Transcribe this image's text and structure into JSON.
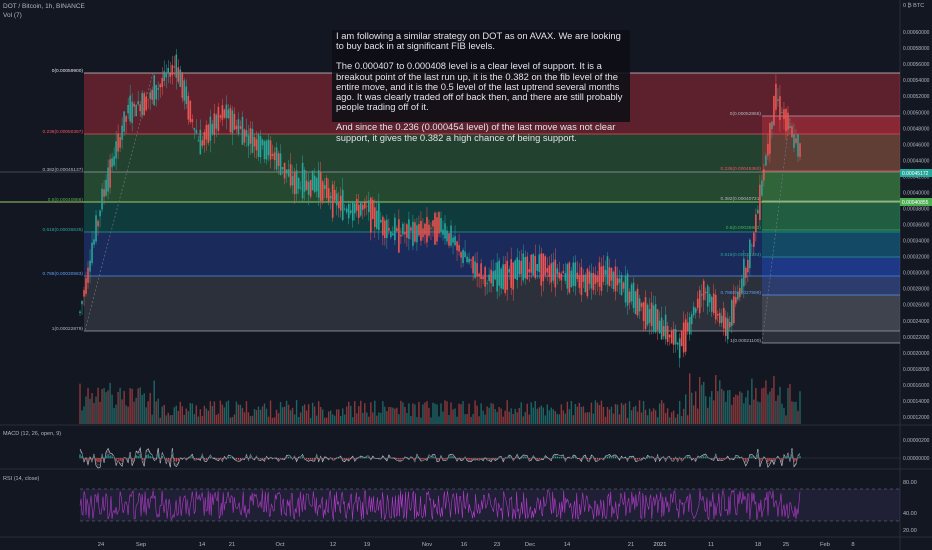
{
  "header": {
    "symbol": "DOT / Bitcoin, 1h, BINANCE",
    "vol": "Vol (7)",
    "price_axis_unit": "0 ₿ BTC"
  },
  "note": {
    "p1": "I am following a similar strategy on DOT as on AVAX. We are looking to buy back in at significant FIB levels.",
    "p2": "The 0.000407 to 0.000408 level is a clear level of support. It is a breakout point of the last run up, it is the 0.382 on the fib level of the entire move, and it is the 0.5 level of the last uptrend several months ago. It was clearly traded off of back then, and there are still probably people trading off of it.",
    "p3": "And since the 0.236 (0.000454 level) of the last move was not clear support, it gives the 0.382 a high chance of being support."
  },
  "fib_left": [
    {
      "label": "0(0.00059900)",
      "color": "#e0e0e0"
    },
    {
      "label": "0.236(0.00050397)",
      "color": "#f7525f"
    },
    {
      "label": "0.382(0.00045137)",
      "color": "#b2b5be"
    },
    {
      "label": "0.5(0.00040886)",
      "color": "#4caf50"
    },
    {
      "label": "0.618(0.00036635)",
      "color": "#26a69a"
    },
    {
      "label": "0.786(0.00030583)",
      "color": "#5b9cf6"
    },
    {
      "label": "1(0.00022879)",
      "color": "#b2b5be"
    }
  ],
  "fib_right": [
    {
      "label": "0(0.00052865)",
      "color": "#b2b5be"
    },
    {
      "label": "0.236(0.00045360)",
      "color": "#f7525f"
    },
    {
      "label": "0.382(0.00040721)",
      "color": "#b2b5be"
    },
    {
      "label": "0.5(0.00036983)",
      "color": "#4caf50"
    },
    {
      "label": "0.618(0.00033234)",
      "color": "#26a69a"
    },
    {
      "label": "0.786(0.00027899)",
      "color": "#5b9cf6"
    },
    {
      "label": "1(0.00021100)",
      "color": "#b2b5be"
    }
  ],
  "price_badges": [
    {
      "label": "0.00045172",
      "color": "#26a69a"
    },
    {
      "label": "0.00040855",
      "color": "#4caf50"
    }
  ],
  "macd": {
    "title": "MACD (12, 26, open, 9)",
    "ticks": [
      "0.00000200",
      "0.00000000"
    ]
  },
  "rsi": {
    "title": "RSI (14, close)",
    "ticks": [
      "80.00",
      "40.00",
      "20.00"
    ]
  },
  "chart_data": {
    "type": "line",
    "title": "DOT / Bitcoin, 1h, BINANCE",
    "xlabel": "",
    "ylabel": "",
    "x_ticks": [
      "24",
      "Sep",
      "14",
      "21",
      "Oct",
      "12",
      "19",
      "Nov",
      "16",
      "23",
      "Dec",
      "14",
      "21",
      "2021",
      "11",
      "18",
      "25",
      "Feb",
      "8"
    ],
    "y_ticks": [
      "0.00060000",
      "0.00058000",
      "0.00056000",
      "0.00054000",
      "0.00052000",
      "0.00050000",
      "0.00048000",
      "0.00046000",
      "0.00044000",
      "0.00042000",
      "0.00040000",
      "0.00038000",
      "0.00036000",
      "0.00034000",
      "0.00032000",
      "0.00030000",
      "0.00028000",
      "0.00026000",
      "0.00024000",
      "0.00022000",
      "0.00020000",
      "0.00018000",
      "0.00016000",
      "0.00014000",
      "0.00012000"
    ],
    "ylim": [
      0.00011,
      0.00064
    ],
    "series": [
      {
        "values": [
          0.00025,
          0.0004,
          0.0005,
          0.00052,
          0.00056,
          0.00046,
          0.0005,
          0.00047,
          0.00045,
          0.00041,
          0.00041,
          0.00038,
          0.00038,
          0.00035,
          0.00035,
          0.00036,
          0.00032,
          0.00029,
          0.0003,
          0.00031,
          0.0003,
          0.00029,
          0.0003,
          0.00027,
          0.00024,
          0.00021,
          0.00028,
          0.00023,
          0.00033,
          0.00052,
          0.00045
        ]
      }
    ]
  }
}
